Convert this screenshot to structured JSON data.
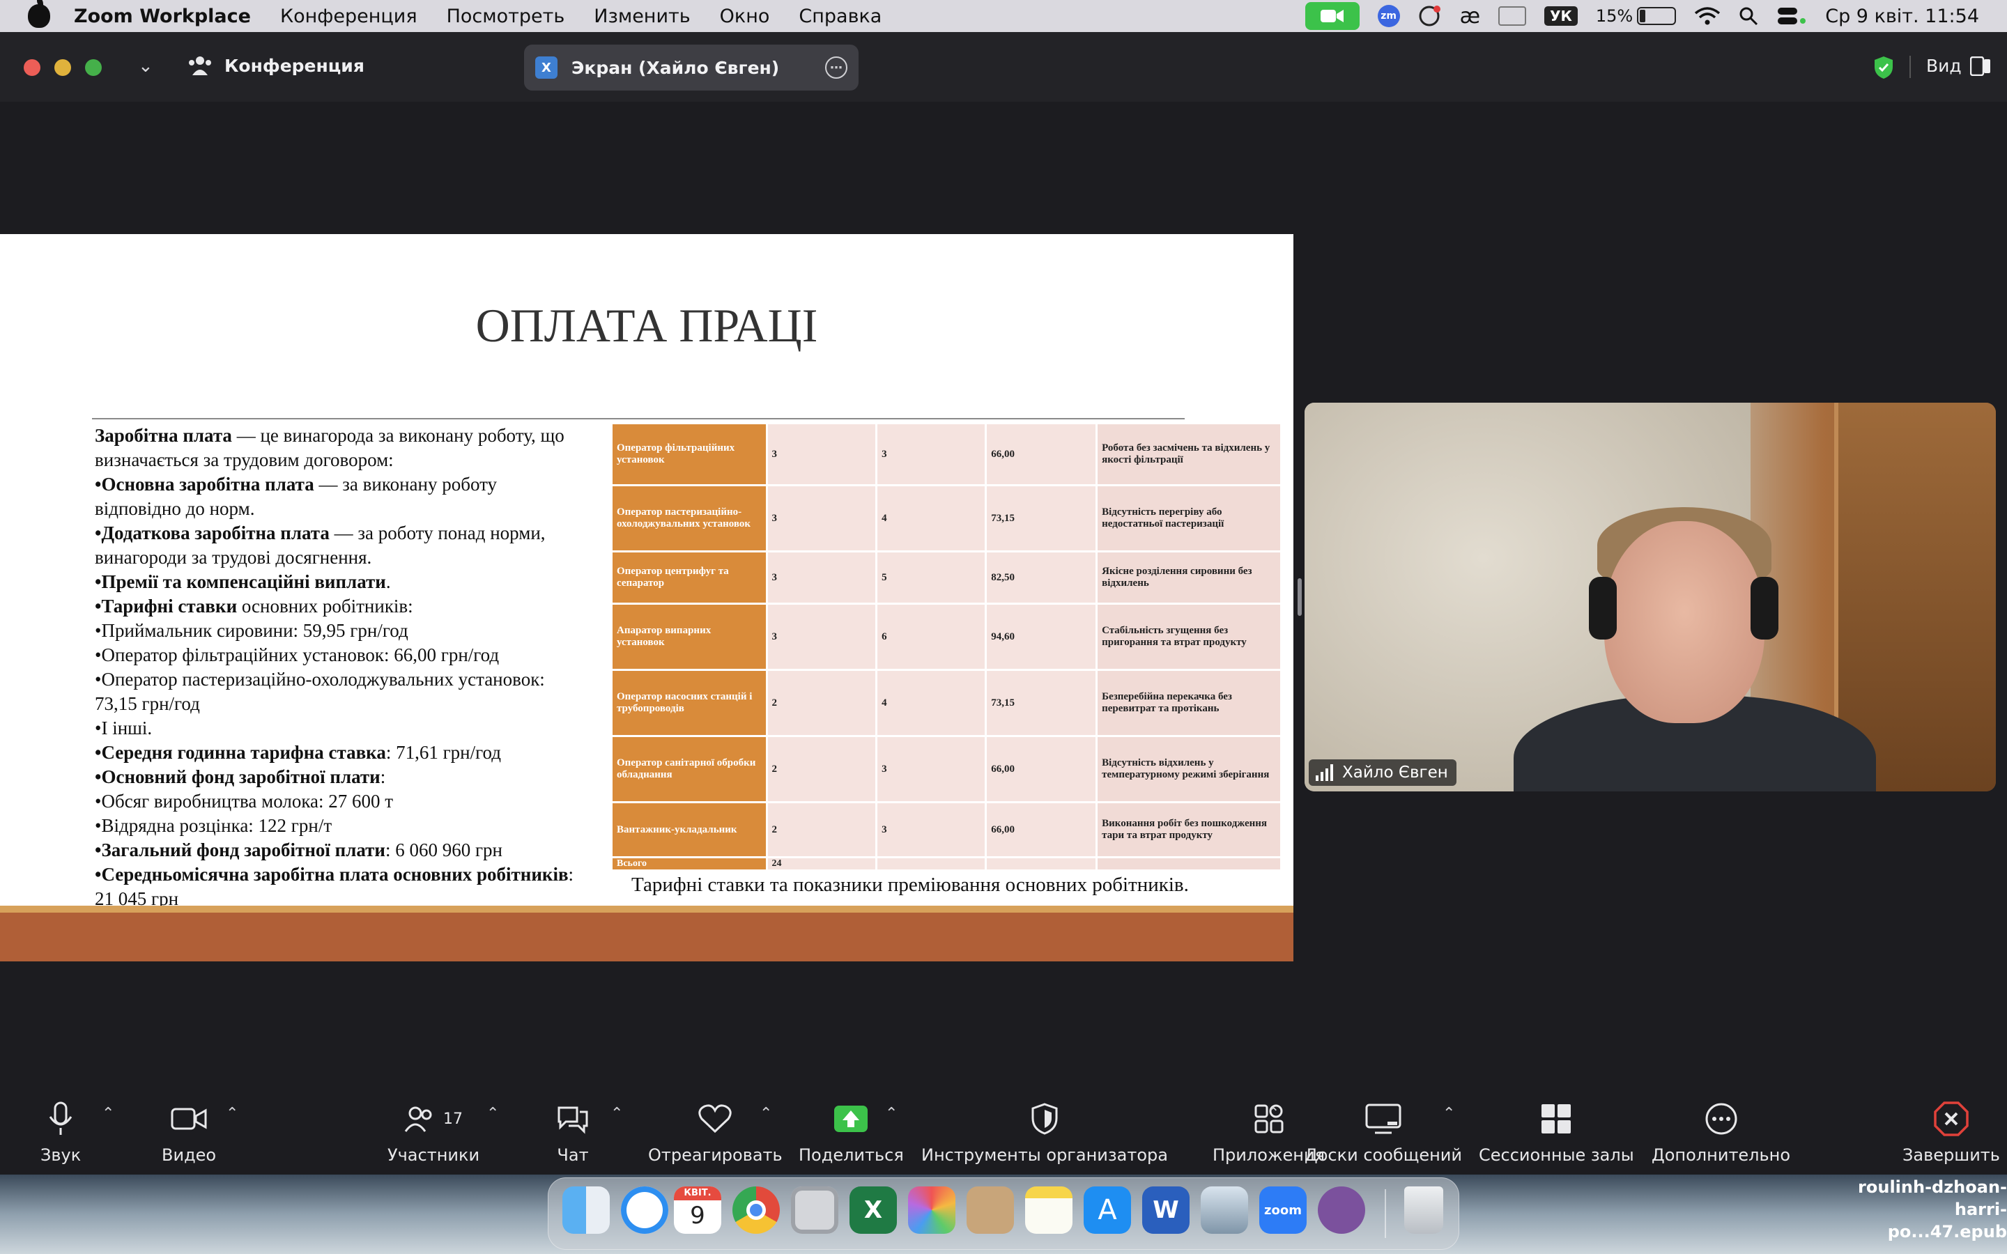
{
  "menubar": {
    "app_name": "Zoom Workplace",
    "menus": [
      "Конференция",
      "Посмотреть",
      "Изменить",
      "Окно",
      "Справка"
    ],
    "keyboard_layout": "УК",
    "battery_percent": "15%",
    "datetime": "Ср 9 квіт.  11:54"
  },
  "window": {
    "title": "Конференция",
    "tab_label": "Экран (Хайло Євген)",
    "tab_badge": "X",
    "view_label": "Вид"
  },
  "slide": {
    "title": "ОПЛАТА ПРАЦІ",
    "paragraphs": [
      {
        "bold": "Заробітна плата",
        "text": " — це винагорода за виконану роботу, що визначається за трудовим договором:"
      },
      {
        "bold": "•Основна заробітна плата",
        "text": " — за виконану роботу відповідно до норм."
      },
      {
        "bold": "•Додаткова заробітна плата",
        "text": " — за роботу понад норми, винагороди за трудові досягнення."
      },
      {
        "bold": "•Премії та компенсаційні виплати",
        "text": "."
      },
      {
        "bold": "•Тарифні ставки",
        "text": " основних робітників:"
      },
      {
        "bold": "",
        "text": "•Приймальник сировини: 59,95 грн/год"
      },
      {
        "bold": "",
        "text": "•Оператор фільтраційних установок: 66,00 грн/год"
      },
      {
        "bold": "",
        "text": "•Оператор пастеризаційно-охолоджувальних установок: 73,15 грн/год"
      },
      {
        "bold": "",
        "text": "•І інші."
      },
      {
        "bold": "•Середня годинна тарифна ставка",
        "text": ": 71,61 грн/год"
      },
      {
        "bold": "•Основний фонд заробітної плати",
        "text": ":"
      },
      {
        "bold": "",
        "text": "•Обсяг виробництва молока: 27 600 т"
      },
      {
        "bold": "",
        "text": "•Відрядна розцінка: 122 грн/т"
      },
      {
        "bold": "•Загальний фонд заробітної плати",
        "text": ": 6 060 960 грн"
      },
      {
        "bold": "•Середньомісячна заробітна плата основних робітників",
        "text": ": 21 045 грн"
      }
    ],
    "table_rows": [
      [
        "Оператор фільтраційних установок",
        "3",
        "3",
        "66,00",
        "Робота без засмічень та відхилень у якості фільтрації"
      ],
      [
        "Оператор пастеризаційно-охолоджувальних установок",
        "3",
        "4",
        "73,15",
        "Відсутність перегріву або недостатньої пастеризації"
      ],
      [
        "Оператор центрифуг та сепаратор",
        "3",
        "5",
        "82,50",
        "Якісне розділення сировини без відхилень"
      ],
      [
        "Апаратор випарних установок",
        "3",
        "6",
        "94,60",
        "Стабільність згущення без пригорання та втрат продукту"
      ],
      [
        "Оператор насосних станцій і трубопроводів",
        "2",
        "4",
        "73,15",
        "Безперебійна перекачка без перевитрат та протікань"
      ],
      [
        "Оператор санітарної обробки обладнання",
        "2",
        "3",
        "66,00",
        "Відсутність відхилень у температурному режимі зберігання"
      ],
      [
        "Вантажник-укладальник",
        "2",
        "3",
        "66,00",
        "Виконання робіт без пошкодження тари та втрат продукту"
      ],
      [
        "Всього",
        "24",
        "",
        "",
        ""
      ]
    ],
    "caption": "Тарифні ставки та показники преміювання основних робітників."
  },
  "video": {
    "participant_name": "Хайло Євген"
  },
  "toolbar": {
    "audio": "Звук",
    "video": "Видео",
    "participants": "Участники",
    "participants_count": "17",
    "chat": "Чат",
    "react": "Отреагировать",
    "share": "Поделиться",
    "host_tools": "Инструменты организатора",
    "apps": "Приложения",
    "whiteboards": "Доски сообщений",
    "breakout": "Сессионные залы",
    "more": "Дополнительно",
    "end": "Завершить"
  },
  "dock": {
    "calendar_month": "КВІТ.",
    "calendar_day": "9",
    "zoom_label": "zoom",
    "desktop_file": [
      "roulinh-dzhoan-",
      "harri-po...47.epub"
    ]
  }
}
